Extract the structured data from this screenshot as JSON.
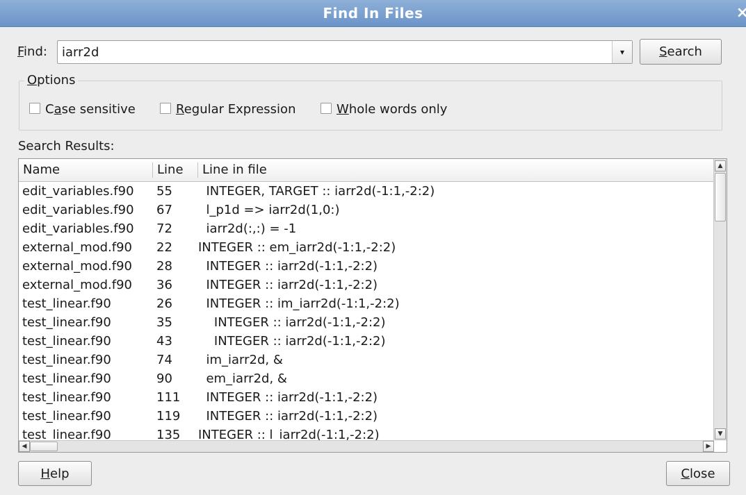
{
  "window": {
    "title": "Find In Files",
    "close_glyph": "×"
  },
  "find": {
    "label_prefix": "",
    "label_mnemonic": "F",
    "label_rest": "ind:",
    "value": "iarr2d",
    "dropdown_glyph": "▾",
    "search_mnemonic": "S",
    "search_rest": "earch"
  },
  "options": {
    "title_mnemonic": "O",
    "title_rest": "ptions",
    "case": {
      "prefix": "C",
      "mnemonic": "a",
      "rest": "se sensitive",
      "checked": false
    },
    "regex": {
      "prefix": "",
      "mnemonic": "R",
      "rest": "egular Expression",
      "checked": false
    },
    "whole": {
      "prefix": "",
      "mnemonic": "W",
      "rest": "hole words only",
      "checked": false
    }
  },
  "results": {
    "label": "Search Results:",
    "columns": [
      "Name",
      "Line",
      "Line in file"
    ],
    "rows": [
      {
        "name": "edit_variables.f90",
        "line": "55",
        "text": "  INTEGER, TARGET :: iarr2d(-1:1,-2:2)"
      },
      {
        "name": "edit_variables.f90",
        "line": "67",
        "text": "  l_p1d => iarr2d(1,0:)"
      },
      {
        "name": "edit_variables.f90",
        "line": "72",
        "text": "  iarr2d(:,:) = -1"
      },
      {
        "name": "external_mod.f90",
        "line": "22",
        "text": "INTEGER :: em_iarr2d(-1:1,-2:2)"
      },
      {
        "name": "external_mod.f90",
        "line": "28",
        "text": "  INTEGER :: iarr2d(-1:1,-2:2)"
      },
      {
        "name": "external_mod.f90",
        "line": "36",
        "text": "  INTEGER :: iarr2d(-1:1,-2:2)"
      },
      {
        "name": "test_linear.f90",
        "line": "26",
        "text": "  INTEGER :: im_iarr2d(-1:1,-2:2)"
      },
      {
        "name": "test_linear.f90",
        "line": "35",
        "text": "    INTEGER :: iarr2d(-1:1,-2:2)"
      },
      {
        "name": "test_linear.f90",
        "line": "43",
        "text": "    INTEGER :: iarr2d(-1:1,-2:2)"
      },
      {
        "name": "test_linear.f90",
        "line": "74",
        "text": "  im_iarr2d, &"
      },
      {
        "name": "test_linear.f90",
        "line": "90",
        "text": "  em_iarr2d, &"
      },
      {
        "name": "test_linear.f90",
        "line": "111",
        "text": "  INTEGER :: iarr2d(-1:1,-2:2)"
      },
      {
        "name": "test_linear.f90",
        "line": "119",
        "text": "  INTEGER :: iarr2d(-1:1,-2:2)"
      },
      {
        "name": "test_linear.f90",
        "line": "135",
        "text": "INTEGER :: l_iarr2d(-1:1,-2:2)"
      }
    ]
  },
  "scroll": {
    "up_glyph": "▲",
    "down_glyph": "▼",
    "left_glyph": "◀",
    "right_glyph": "▶"
  },
  "footer": {
    "help_mnemonic": "H",
    "help_rest": "elp",
    "close_mnemonic": "C",
    "close_rest": "lose"
  }
}
